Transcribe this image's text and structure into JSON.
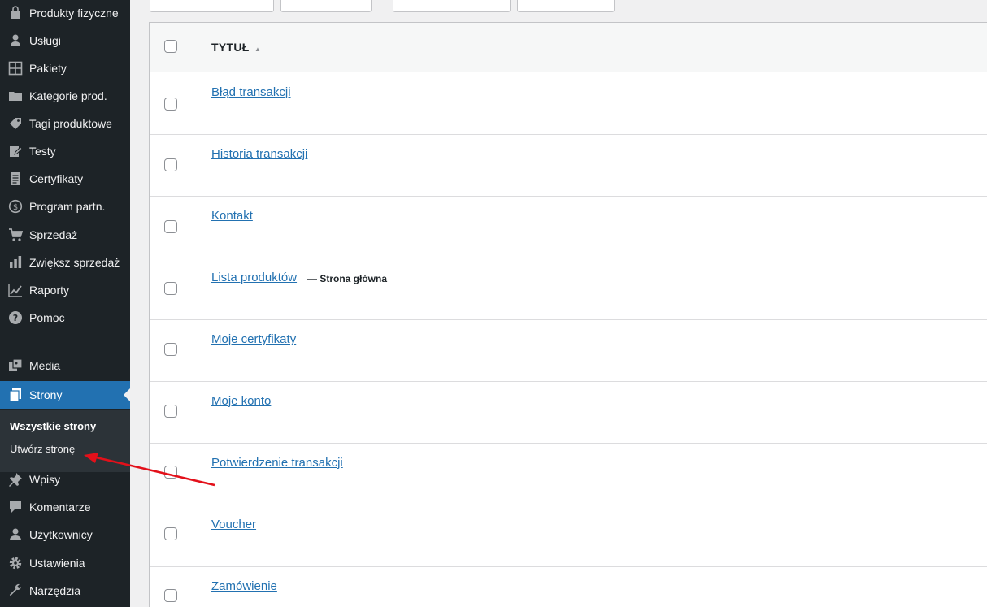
{
  "sidebar": {
    "items": [
      {
        "label": "Produkty fizyczne",
        "icon": "shopping-bag-icon"
      },
      {
        "label": "Usługi",
        "icon": "user-service-icon"
      },
      {
        "label": "Pakiety",
        "icon": "grid-icon"
      },
      {
        "label": "Kategorie prod.",
        "icon": "folder-icon"
      },
      {
        "label": "Tagi produktowe",
        "icon": "tag-icon"
      },
      {
        "label": "Testy",
        "icon": "edit-icon"
      },
      {
        "label": "Certyfikaty",
        "icon": "document-icon"
      },
      {
        "label": "Program partn.",
        "icon": "dollar-icon"
      },
      {
        "label": "Sprzedaż",
        "icon": "cart-icon"
      },
      {
        "label": "Zwiększ sprzedaż",
        "icon": "bar-chart-icon"
      },
      {
        "label": "Raporty",
        "icon": "line-chart-icon"
      },
      {
        "label": "Pomoc",
        "icon": "help-icon"
      },
      {
        "label": "Media",
        "icon": "media-icon"
      },
      {
        "label": "Strony",
        "icon": "pages-icon"
      },
      {
        "label": "Wpisy",
        "icon": "pin-icon"
      },
      {
        "label": "Komentarze",
        "icon": "comment-icon"
      },
      {
        "label": "Użytkownicy",
        "icon": "users-icon"
      },
      {
        "label": "Ustawienia",
        "icon": "settings-icon"
      },
      {
        "label": "Narzędzia",
        "icon": "wrench-icon"
      }
    ],
    "submenu": {
      "all_pages": "Wszystkie strony",
      "create_page": "Utwórz stronę"
    }
  },
  "table": {
    "header_title": "TYTUŁ",
    "rows": [
      {
        "title": "Błąd transakcji",
        "state": ""
      },
      {
        "title": "Historia transakcji",
        "state": ""
      },
      {
        "title": "Kontakt",
        "state": ""
      },
      {
        "title": "Lista produktów",
        "state": "— Strona główna"
      },
      {
        "title": "Moje certyfikaty",
        "state": ""
      },
      {
        "title": "Moje konto",
        "state": ""
      },
      {
        "title": "Potwierdzenie transakcji",
        "state": ""
      },
      {
        "title": "Voucher",
        "state": ""
      },
      {
        "title": "Zamówienie",
        "state": ""
      }
    ]
  },
  "colors": {
    "sidebar_bg": "#1d2327",
    "active_bg": "#2271b1",
    "link": "#2271b1",
    "arrow": "#e3101a"
  }
}
